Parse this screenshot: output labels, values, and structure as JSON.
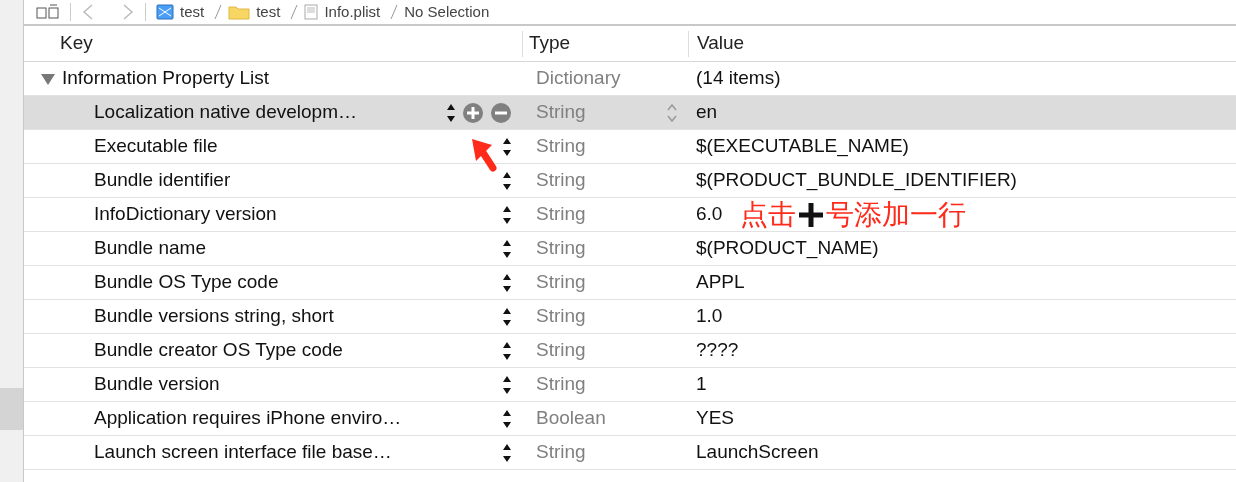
{
  "breadcrumb": [
    {
      "kind": "project",
      "label": "test"
    },
    {
      "kind": "folder",
      "label": "test"
    },
    {
      "kind": "plist",
      "label": "Info.plist"
    },
    {
      "kind": "none",
      "label": "No Selection"
    }
  ],
  "columns": [
    "Key",
    "Type",
    "Value"
  ],
  "root": {
    "key": "Information Property List",
    "type": "Dictionary",
    "value": "(14 items)",
    "expanded": true,
    "selected": false,
    "children": [
      {
        "key": "Localization native developm…",
        "type": "String",
        "value": "en",
        "selected": true
      },
      {
        "key": "Executable file",
        "type": "String",
        "value": "$(EXECUTABLE_NAME)",
        "selected": false
      },
      {
        "key": "Bundle identifier",
        "type": "String",
        "value": "$(PRODUCT_BUNDLE_IDENTIFIER)",
        "selected": false
      },
      {
        "key": "InfoDictionary version",
        "type": "String",
        "value": "6.0",
        "selected": false,
        "note": {
          "text_before": "点击",
          "text_after": "号添加一行"
        }
      },
      {
        "key": "Bundle name",
        "type": "String",
        "value": "$(PRODUCT_NAME)",
        "selected": false
      },
      {
        "key": "Bundle OS Type code",
        "type": "String",
        "value": "APPL",
        "selected": false
      },
      {
        "key": "Bundle versions string, short",
        "type": "String",
        "value": "1.0",
        "selected": false
      },
      {
        "key": "Bundle creator OS Type code",
        "type": "String",
        "value": "????",
        "selected": false
      },
      {
        "key": "Bundle version",
        "type": "String",
        "value": "1",
        "selected": false
      },
      {
        "key": "Application requires iPhone enviro…",
        "type": "Boolean",
        "value": "YES",
        "selected": false
      },
      {
        "key": "Launch screen interface file base…",
        "type": "String",
        "value": "LaunchScreen",
        "selected": false
      }
    ]
  }
}
